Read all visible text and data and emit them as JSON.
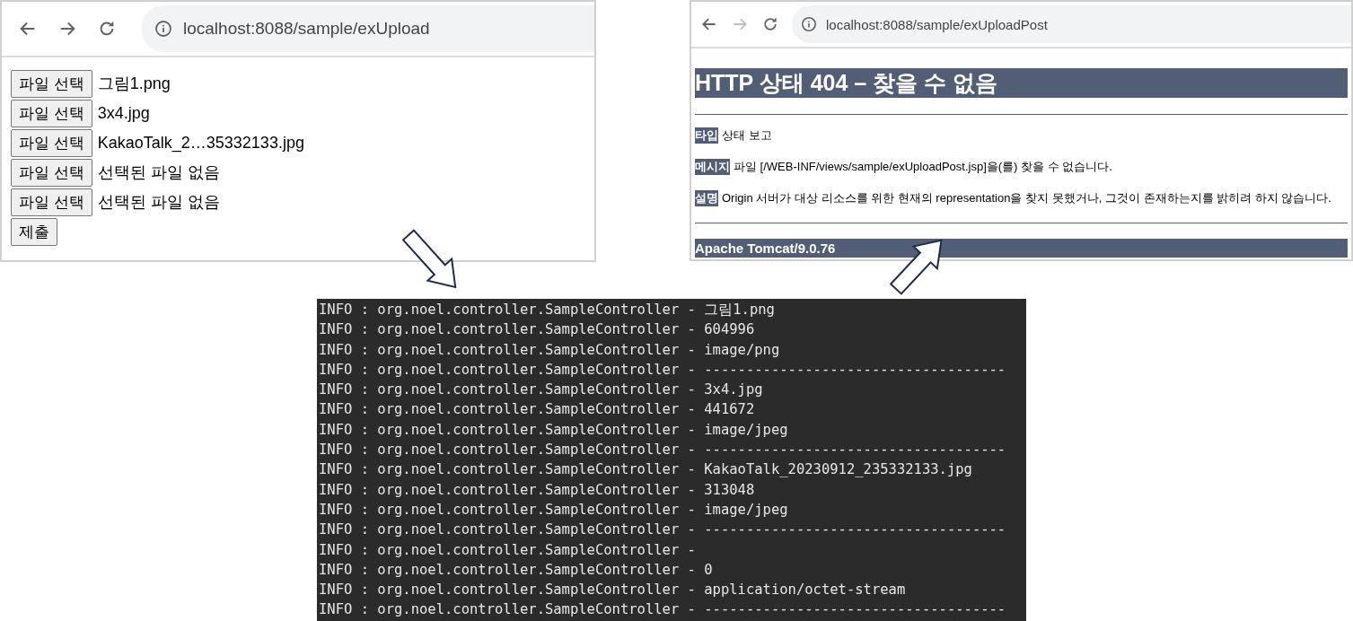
{
  "upload_page": {
    "url": "localhost:8088/sample/exUpload",
    "forward_disabled": false,
    "file_inputs": [
      {
        "button": "파일 선택",
        "file": "그림1.png"
      },
      {
        "button": "파일 선택",
        "file": "3x4.jpg"
      },
      {
        "button": "파일 선택",
        "file": "KakaoTalk_2…35332133.jpg"
      },
      {
        "button": "파일 선택",
        "file": "선택된 파일 없음"
      },
      {
        "button": "파일 선택",
        "file": "선택된 파일 없음"
      }
    ],
    "submit": "제출"
  },
  "error_page": {
    "url": "localhost:8088/sample/exUploadPost",
    "forward_disabled": true,
    "title": "HTTP 상태 404 – 찾을 수 없음",
    "details": [
      {
        "label": "타입",
        "text": "상태 보고"
      },
      {
        "label": "메시지",
        "text": "파일 [/WEB-INF/views/sample/exUploadPost.jsp]을(를) 찾을 수 없습니다."
      },
      {
        "label": "설명",
        "text": "Origin 서버가 대상 리소스를 위한 현재의 representation을 찾지 못했거나, 그것이 존재하는지를 밝히려 하지 않습니다."
      }
    ],
    "footer": "Apache Tomcat/9.0.76"
  },
  "console": {
    "lines": [
      "INFO : org.noel.controller.SampleController - 그림1.png",
      "INFO : org.noel.controller.SampleController - 604996",
      "INFO : org.noel.controller.SampleController - image/png",
      "INFO : org.noel.controller.SampleController - ------------------------------------",
      "INFO : org.noel.controller.SampleController - 3x4.jpg",
      "INFO : org.noel.controller.SampleController - 441672",
      "INFO : org.noel.controller.SampleController - image/jpeg",
      "INFO : org.noel.controller.SampleController - ------------------------------------",
      "INFO : org.noel.controller.SampleController - KakaoTalk_20230912_235332133.jpg",
      "INFO : org.noel.controller.SampleController - 313048",
      "INFO : org.noel.controller.SampleController - image/jpeg",
      "INFO : org.noel.controller.SampleController - ------------------------------------",
      "INFO : org.noel.controller.SampleController -",
      "INFO : org.noel.controller.SampleController - 0",
      "INFO : org.noel.controller.SampleController - application/octet-stream",
      "INFO : org.noel.controller.SampleController - ------------------------------------"
    ]
  }
}
